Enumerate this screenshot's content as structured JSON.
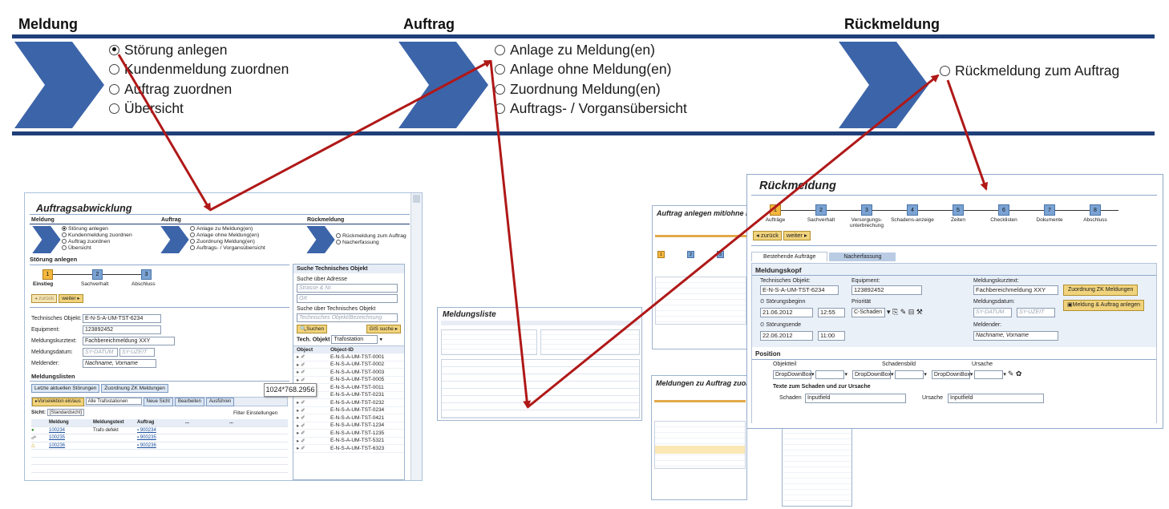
{
  "header": {
    "col1_title": "Meldung",
    "col2_title": "Auftrag",
    "col3_title": "Rückmeldung",
    "col1_options": [
      "Störung anlegen",
      "Kundenmeldung zuordnen",
      "Auftrag zuordnen",
      "Übersicht"
    ],
    "col2_options": [
      "Anlage zu Meldung(en)",
      "Anlage ohne Meldung(en)",
      "Zuordnung Meldung(en)",
      "Auftrags- / Vorgansübersicht"
    ],
    "col3_options": [
      "Rückmeldung zum Auftrag"
    ],
    "colors": {
      "chevron": "#3c64a9",
      "arrow": "#b01818",
      "rule": "#1f3f79"
    }
  },
  "auftragsabwicklung": {
    "title": "Auftragsabwicklung",
    "col1": "Meldung",
    "col2": "Auftrag",
    "col3": "Rückmeldung",
    "m_opts": [
      "Störung anlegen",
      "Kundenmeldung zuordnen",
      "Auftrag zuordnen",
      "Übersicht"
    ],
    "a_opts": [
      "Anlage zu Meldung(en)",
      "Anlage ohne Meldung(en)",
      "Zuordnung Meldung(en)",
      "Auftrags- / Vorgansübersicht"
    ],
    "r_opts": [
      "Rückmeldung zum Auftrag",
      "Nacherfassung"
    ],
    "section": "Störung anlegen",
    "steps": [
      "Einstieg",
      "Sachverhalt",
      "Abschluss"
    ],
    "back": "zurück",
    "next": "weiter",
    "tech_label": "Technisches Objekt:",
    "tech_value": "E-N-S-A-UM-TST-6234",
    "equip_label": "Equipment:",
    "equip_value": "123892452",
    "kurz_label": "Meldungskurztext:",
    "kurz_value": "Fachbereichmeldung XXY",
    "datum_label": "Meldungsdatum:",
    "datum_ph": "SY-DATUM",
    "zeit_ph": "SY-UZEIT",
    "melder_label": "Meldender:",
    "melder_value": "Nachname, Vorname",
    "listen": "Meldungslisten",
    "btn_letzte": "Letzte aktuellen Störungen",
    "btn_zuord": "Zuordnung ZK Meldungen",
    "tb_vorsel": "Vorselektion ein/aus",
    "tb_alle": "Alle Trafostationen",
    "tb_neu": "Neue Sicht",
    "tb_bearb": "Bearbeiten",
    "tb_ausf": "Ausführen",
    "sicht_label": "Sicht:",
    "sicht_value": "[Standardsicht]",
    "filter": "Filter",
    "einst": "Einstellungen",
    "cols": [
      "Meldung",
      "Meldungstext",
      "Auftrag"
    ],
    "rows": [
      {
        "meldung": "100234",
        "text": "Trafo defekt",
        "auftrag": "900234"
      },
      {
        "meldung": "100235",
        "text": "",
        "auftrag": "900235"
      },
      {
        "meldung": "100236",
        "text": "",
        "auftrag": "900236"
      }
    ],
    "search_title": "Suche Technisches Objekt",
    "search_addr": "Suche über Adresse",
    "addr_ph": "Strasse & Nr.",
    "ort_ph": "Ort",
    "search_tech": "Suche über Technisches Objekt",
    "tech_ph": "Technisches Objekt/Bezeichnung",
    "btn_suchen": "Suchen",
    "btn_gis": "GIS suche",
    "tech_obj_label": "Tech. Objekt",
    "tech_obj_value": "Trafostation",
    "obj_col": "Object",
    "objid_col": "Object-ID",
    "objects": [
      "E-N-S-A-UM-TST-0001",
      "E-N-S-A-UM-TST-0002",
      "E-N-S-A-UM-TST-0003",
      "E-N-S-A-UM-TST-0005",
      "E-N-S-A-UM-TST-0011",
      "E-N-S-A-UM-TST-0231",
      "E-N-S-A-UM-TST-0232",
      "E-N-S-A-UM-TST-0234",
      "E-N-S-A-UM-TST-0421",
      "E-N-S-A-UM-TST-1234",
      "E-N-S-A-UM-TST-1235",
      "E-N-S-A-UM-TST-5321",
      "E-N-S-A-UM-TST-6323"
    ],
    "tooltip": "1024*768.2956"
  },
  "meldungsliste": {
    "title": "Meldungsliste"
  },
  "auftrag_anlegen": {
    "title": "Auftrag anlegen mit/ohne M"
  },
  "meldungen_zu": {
    "title": "Meldungen zu Auftrag zuor"
  },
  "rueckmeldung": {
    "title": "Rückmeldung",
    "steps": [
      {
        "n": "1",
        "label": "Aufträge"
      },
      {
        "n": "2",
        "label": "Sachverhalt"
      },
      {
        "n": "3",
        "label": "Versorgungs-unterbrechung"
      },
      {
        "n": "4",
        "label": "Schadens-anzeige"
      },
      {
        "n": "5",
        "label": "Zeiten"
      },
      {
        "n": "6",
        "label": "Checklisten"
      },
      {
        "n": "7",
        "label": "Dokumente"
      },
      {
        "n": "8",
        "label": "Abschluss"
      }
    ],
    "back": "zurück",
    "next": "weiter",
    "tab1": "Bestehende Aufträge",
    "tab2": "Nacherfassung",
    "kopf": "Meldungskopf",
    "tech_label": "Technisches Objekt:",
    "tech_value": "E-N-S-A-UM-TST-6234",
    "equip_label": "Equipment:",
    "equip_value": "123892452",
    "kurz_label": "Meldungskurztext:",
    "kurz_value": "Fachbereichmeldung XXY",
    "btn_zuord": "Zuordnung ZK Meldungen",
    "beginn_label": "Störungsbeginn",
    "beginn_date": "21.06.2012",
    "beginn_time": "12:55",
    "prio_label": "Priorität",
    "prio_value": "C-Schaden",
    "datum_label": "Meldungsdatum:",
    "datum_ph": "SY-DATUM",
    "zeit_ph": "SY-UZEIT",
    "btn_anlegen": "Meldung & Auftrag anlegen",
    "ende_label": "Störungsende",
    "ende_date": "22.06.2012",
    "ende_time": "11:00",
    "melder_label": "Meldender:",
    "melder_value": "Nachname, Vorname",
    "position": "Position",
    "objteil": "Objektteil",
    "schadensbild": "Schadensbild",
    "ursache_h": "Ursache",
    "dropdown": "DropDownBox",
    "texte": "Texte zum Schaden und zur Ursache",
    "schaden_label": "Schaden",
    "schaden_value": "Inputfield",
    "ursache_label": "Ursache",
    "ursache_value": "Inputfield"
  }
}
